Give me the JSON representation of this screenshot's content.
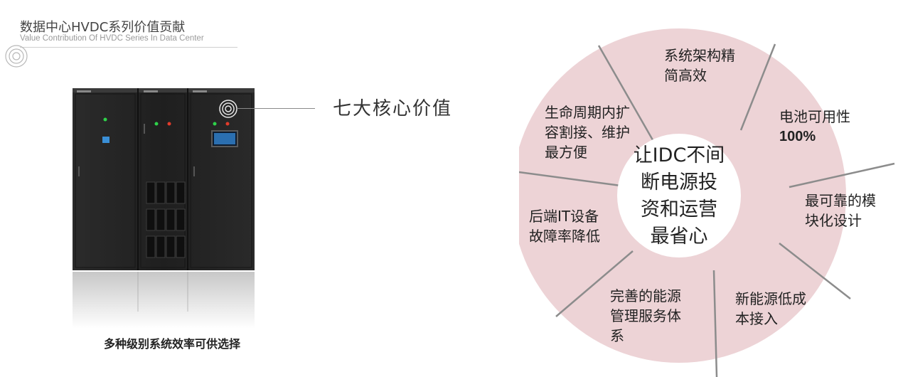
{
  "header": {
    "title": "数据中心HVDC系列价值贡献",
    "subtitle": "Value Contribution Of HVDC Series In Data Center"
  },
  "callout": {
    "text": "七大核心价值"
  },
  "caption": "多种级别系统效率可供选择",
  "wheel": {
    "center_lines": [
      "让IDC不间",
      "断电源投",
      "资和运营",
      "最省心"
    ],
    "segments": [
      {
        "lines": [
          "系统架构精",
          "简高效"
        ]
      },
      {
        "lines": [
          "电池可用性",
          "100%"
        ]
      },
      {
        "lines": [
          "最可靠的模",
          "块化设计"
        ]
      },
      {
        "lines": [
          "新能源低成",
          "本接入"
        ]
      },
      {
        "lines": [
          "完善的能源",
          "管理服务体",
          "系"
        ]
      },
      {
        "lines": [
          "后端IT设备",
          "故障率降低"
        ]
      },
      {
        "lines": [
          "生命周期内扩",
          "容割接、维护",
          "最方便"
        ]
      }
    ],
    "colors": {
      "ring": "#edd3d6",
      "center": "#ffffff",
      "divider": "#8c8c8c"
    }
  }
}
